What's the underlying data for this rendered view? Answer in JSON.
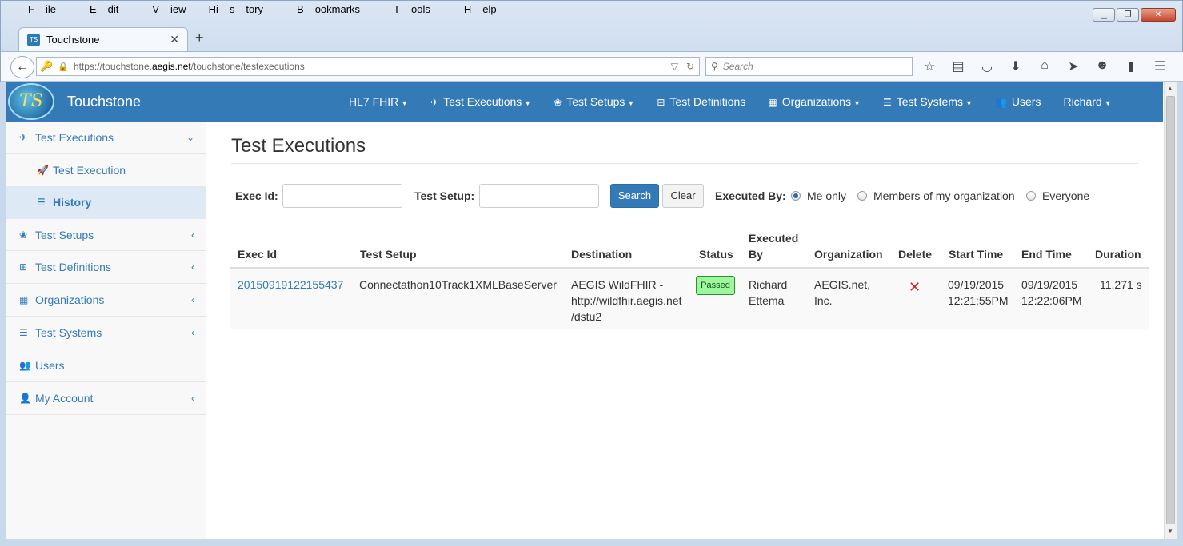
{
  "menubar": [
    {
      "pre": "",
      "u": "F",
      "post": "ile"
    },
    {
      "pre": "",
      "u": "E",
      "post": "dit"
    },
    {
      "pre": "",
      "u": "V",
      "post": "iew"
    },
    {
      "pre": "Hi",
      "u": "s",
      "post": "tory"
    },
    {
      "pre": "",
      "u": "B",
      "post": "ookmarks"
    },
    {
      "pre": "",
      "u": "T",
      "post": "ools"
    },
    {
      "pre": "",
      "u": "H",
      "post": "elp"
    }
  ],
  "tab": {
    "title": "Touchstone",
    "favicon_text": "TS"
  },
  "urlbar": {
    "url_pre": "https://touchstone.",
    "url_host": "aegis.net",
    "url_post": "/touchstone/testexecutions"
  },
  "searchbar": {
    "placeholder": "Search"
  },
  "app": {
    "logo_text": "TS",
    "brand": "Touchstone",
    "nav": [
      {
        "label": "HL7 FHIR",
        "icon": "",
        "caret": true
      },
      {
        "label": "Test Executions",
        "icon": "plane-icon",
        "caret": true
      },
      {
        "label": "Test Setups",
        "icon": "paw-icon",
        "caret": true
      },
      {
        "label": "Test Definitions",
        "icon": "sitemap-icon",
        "caret": false
      },
      {
        "label": "Organizations",
        "icon": "building-icon",
        "caret": true
      },
      {
        "label": "Test Systems",
        "icon": "tasks-icon",
        "caret": true
      },
      {
        "label": "Users",
        "icon": "users-icon",
        "caret": false
      },
      {
        "label": "Richard",
        "icon": "",
        "caret": true
      }
    ]
  },
  "sidebar": {
    "items": [
      {
        "label": "Test Executions",
        "icon": "plane-icon",
        "chev": "down"
      },
      {
        "label": "Test Execution",
        "icon": "rocket-icon",
        "sub": true
      },
      {
        "label": "History",
        "icon": "list-icon",
        "sub": true,
        "active": true
      },
      {
        "label": "Test Setups",
        "icon": "paw-icon",
        "chev": "left"
      },
      {
        "label": "Test Definitions",
        "icon": "sitemap-icon",
        "chev": "left"
      },
      {
        "label": "Organizations",
        "icon": "building-icon",
        "chev": "left"
      },
      {
        "label": "Test Systems",
        "icon": "tasks-icon",
        "chev": "left"
      },
      {
        "label": "Users",
        "icon": "users-icon"
      },
      {
        "label": "My Account",
        "icon": "user-icon",
        "chev": "left"
      }
    ]
  },
  "main": {
    "title": "Test Executions",
    "form": {
      "exec_id_label": "Exec Id:",
      "exec_id_value": "",
      "test_setup_label": "Test Setup:",
      "test_setup_value": "",
      "search_label": "Search",
      "clear_label": "Clear",
      "executed_by_label": "Executed By:",
      "radio_me": "Me only",
      "radio_org": "Members of my organization",
      "radio_all": "Everyone",
      "selected": "Me only"
    },
    "table": {
      "headers": {
        "exec_id": "Exec Id",
        "test_setup": "Test Setup",
        "destination": "Destination",
        "status": "Status",
        "executed_by_1": "Executed",
        "executed_by_2": "By",
        "organization": "Organization",
        "delete": "Delete",
        "start_time": "Start Time",
        "end_time": "End Time",
        "duration": "Duration"
      },
      "rows": [
        {
          "exec_id": "20150919122155437",
          "test_setup": "Connectathon10Track1XMLBaseServer",
          "destination_1": "AEGIS WildFHIR -",
          "destination_2": "http://wildfhir.aegis.net",
          "destination_3": "/dstu2",
          "status": "Passed",
          "executed_by_1": "Richard",
          "executed_by_2": "Ettema",
          "organization_1": "AEGIS.net,",
          "organization_2": "Inc.",
          "delete": "✕",
          "start_date": "09/19/2015",
          "start_time": "12:21:55PM",
          "end_date": "09/19/2015",
          "end_time": "12:22:06PM",
          "duration": "11.271 s"
        }
      ]
    }
  },
  "colors": {
    "brand": "#337ab7",
    "passed_bg": "#9df89d",
    "delete": "#e02020"
  }
}
